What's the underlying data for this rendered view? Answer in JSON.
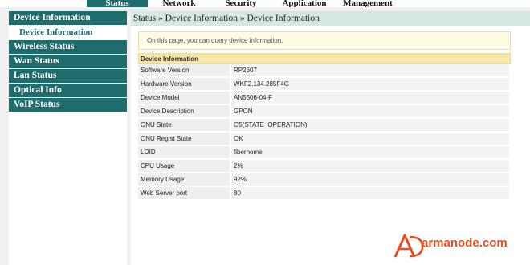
{
  "top_nav": {
    "tabs": [
      {
        "label": "Status",
        "active": true
      },
      {
        "label": "Network",
        "active": false
      },
      {
        "label": "Security",
        "active": false
      },
      {
        "label": "Application",
        "active": false
      },
      {
        "label": "Management",
        "active": false
      }
    ]
  },
  "sidebar": {
    "items": [
      {
        "label": "Device Information"
      },
      {
        "label": "Device Information",
        "sub": true
      },
      {
        "label": "Wireless Status"
      },
      {
        "label": "Wan Status"
      },
      {
        "label": "Lan Status"
      },
      {
        "label": "Optical Info"
      },
      {
        "label": "VoIP Status"
      }
    ]
  },
  "breadcrumb": "Status » Device Information » Device Information",
  "info_message": "On this page, you can query device information.",
  "device_table": {
    "title": "Device Information",
    "rows": [
      {
        "key": "Software Version",
        "value": "RP2607"
      },
      {
        "key": "Hardware Version",
        "value": "WKF2.134.285F4G"
      },
      {
        "key": "Device Model",
        "value": "AN5506-04-F"
      },
      {
        "key": "Device Description",
        "value": "GPON"
      },
      {
        "key": "ONU State",
        "value": "O5(STATE_OPERATION)"
      },
      {
        "key": "ONU Regist State",
        "value": "OK"
      },
      {
        "key": "LOID",
        "value": "fiberhome"
      },
      {
        "key": "CPU Usage",
        "value": "2%"
      },
      {
        "key": "Memory Usage",
        "value": "92%"
      },
      {
        "key": "Web Server port",
        "value": "80"
      }
    ]
  },
  "watermark": {
    "text": "armanode.com",
    "color": "#e84b1f"
  },
  "colors": {
    "accent": "#1f6c6c",
    "breadcrumb_bg": "#d6e8e4",
    "info_bg": "#fffbe3",
    "table_head_bg": "#f6e7a8"
  }
}
